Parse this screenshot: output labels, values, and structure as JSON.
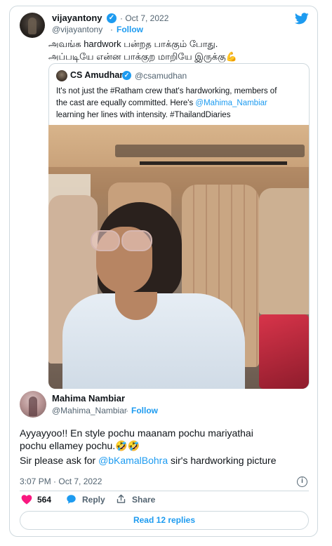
{
  "tweet": {
    "author_name": "vijayantony",
    "date": "· Oct 7, 2022",
    "handle": "@vijayantony",
    "separator": "·",
    "follow_label": "Follow",
    "lines": [
      "அவங்க hardwork பன்றத பாக்கும் போது.",
      "அப்படியே என்ன பாக்குற மாறியே இருக்கு💪"
    ]
  },
  "quote": {
    "author_name": "CS Amudhan",
    "handle": "@csamudhan",
    "line1": "It's not just the #Ratham crew that's hardworking, members of",
    "line2_a": "the cast are equally committed. Here's ",
    "line2_mention": "@Mahima_Nambiar",
    "line3": "learning her lines with intensity. #ThailandDiaries"
  },
  "reply": {
    "author_name": "Mahima Nambiar",
    "handle": "@Mahima_Nambiar",
    "separator": "·",
    "follow_label": "Follow",
    "line1": "Ayyayyoo!! En style pochu maanam pochu mariyathai",
    "line2": "pochu ellamey pochu.🤣🤣",
    "line3_a": "Sir please ask for ",
    "line3_mention": "@bKamalBohra",
    "line3_b": " sir's hardworking picture",
    "timestamp": "3:07 PM · Oct 7, 2022",
    "likes": "564",
    "reply_label": "Reply",
    "share_label": "Share",
    "read_replies_label": "Read 12 replies"
  },
  "icons": {
    "brand": "twitter-bird-icon",
    "verified": "verified-badge-icon",
    "info": "info-icon",
    "like": "heart-icon",
    "reply": "speech-bubble-icon",
    "share": "share-icon"
  },
  "colors": {
    "accent": "#1d9bf0",
    "like": "#f91880",
    "text": "#0f1419",
    "secondary": "#536471",
    "border": "#cfd9de"
  }
}
